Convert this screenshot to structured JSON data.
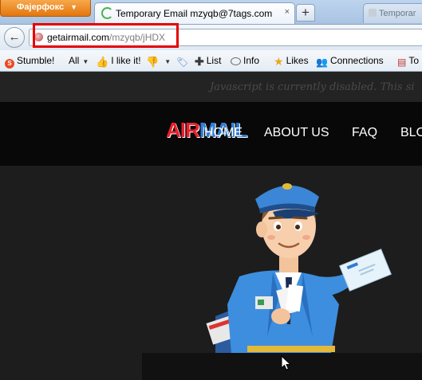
{
  "browser": {
    "menu_label": "Фајерфокс",
    "tab_title": "Temporary Email mzyqb@7tags.com",
    "tab_close": "×",
    "new_tab": "+",
    "second_tab": "Temporar",
    "back": "←",
    "url_host": "getairmail.com",
    "url_path": "/mzyqb/jHDX"
  },
  "bookmarks": [
    {
      "label": "Stumble!",
      "icon": "stumbleupon-icon"
    },
    {
      "label": "All",
      "icon": "dropdown"
    },
    {
      "label": "I like it!",
      "icon": "thumbs-up-icon"
    },
    {
      "label": "",
      "icon": "thumbs-down-icon"
    },
    {
      "label": "",
      "icon": "tag-icon"
    },
    {
      "label": "List",
      "icon": "plus-icon"
    },
    {
      "label": "Info",
      "icon": "comment-icon"
    },
    {
      "label": "Likes",
      "icon": "star-icon"
    },
    {
      "label": "Connections",
      "icon": "people-icon"
    },
    {
      "label": "To",
      "icon": "document-icon"
    }
  ],
  "page": {
    "js_notice": "Javascript is currently disabled. This si",
    "logo_part1": "AIR",
    "logo_part2": "MAIL",
    "nav": [
      "HOME",
      "ABOUT US",
      "FAQ",
      "BLO"
    ]
  },
  "colors": {
    "highlight": "#e60000",
    "logo_red": "#e8202c",
    "logo_blue": "#2f7cd6",
    "firefox_orange": "#e2760f"
  }
}
